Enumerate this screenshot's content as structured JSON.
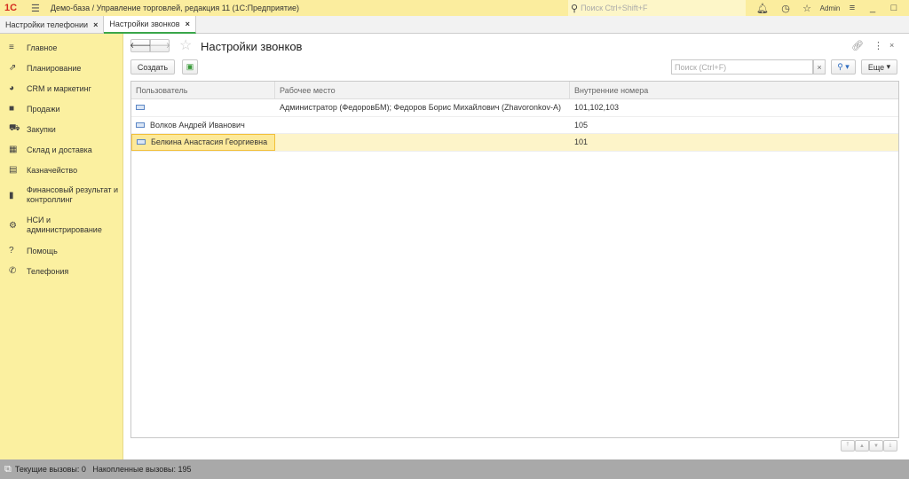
{
  "titlebar": {
    "logo": "1С",
    "title": "Демо-база / Управление торговлей, редакция 11  (1С:Предприятие)",
    "search_placeholder": "Поиск Ctrl+Shift+F",
    "user": "Admin"
  },
  "tabs": [
    {
      "label": "Настройки телефонии"
    },
    {
      "label": "Настройки звонков"
    }
  ],
  "sidebar": {
    "items": [
      {
        "label": "Главное",
        "icon": "≡"
      },
      {
        "label": "Планирование",
        "icon": "⇗"
      },
      {
        "label": "CRM и маркетинг",
        "icon": "◕"
      },
      {
        "label": "Продажи",
        "icon": "■"
      },
      {
        "label": "Закупки",
        "icon": "⛟"
      },
      {
        "label": "Склад и доставка",
        "icon": "▦"
      },
      {
        "label": "Казначейство",
        "icon": "▤"
      },
      {
        "label": "Финансовый результат и контроллинг",
        "icon": "▮"
      },
      {
        "label": "НСИ и администрирование",
        "icon": "⚙"
      },
      {
        "label": "Помощь",
        "icon": "?"
      },
      {
        "label": "Телефония",
        "icon": "✆"
      }
    ]
  },
  "form": {
    "title": "Настройки звонков",
    "create_label": "Создать",
    "search_placeholder": "Поиск (Ctrl+F)",
    "more_label": "Еще"
  },
  "table": {
    "columns": [
      "Пользователь",
      "Рабочее место",
      "Внутренние номера"
    ],
    "rows": [
      {
        "user": "",
        "workplace": "Администратор (ФедоровБМ); Федоров Борис Михайлович (Zhavoronkov-A)",
        "numbers": "101,102,103"
      },
      {
        "user": "Волков Андрей Иванович",
        "workplace": "",
        "numbers": "105"
      },
      {
        "user": "Белкина Анастасия Георгиевна",
        "workplace": "",
        "numbers": "101"
      }
    ]
  },
  "status": {
    "text": "Текущие вызовы: 0   Накопленные вызовы: 195"
  }
}
